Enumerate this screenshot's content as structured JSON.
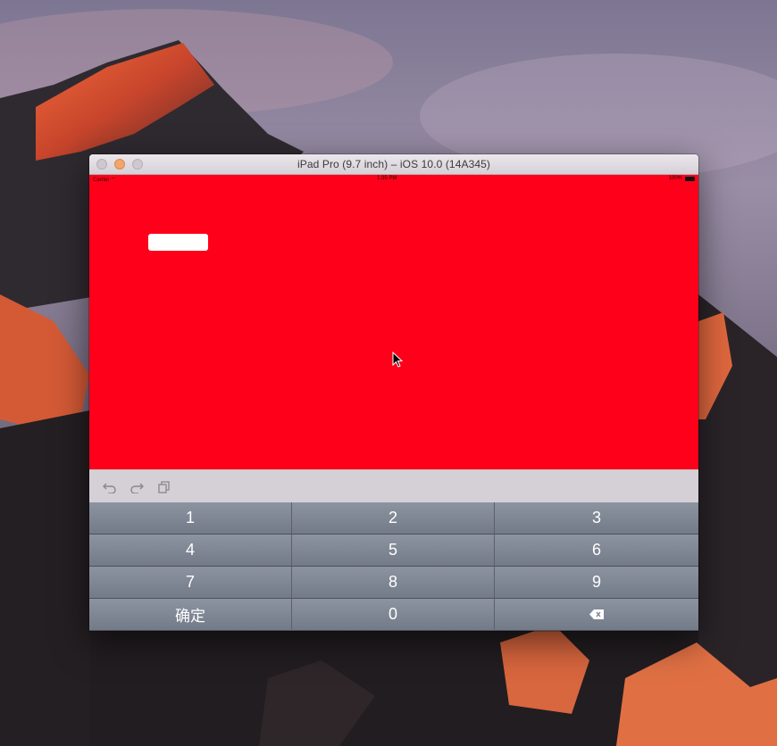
{
  "window": {
    "title": "iPad Pro (9.7 inch) – iOS 10.0 (14A345)"
  },
  "statusbar": {
    "carrier": "Carrier ⌔",
    "time": "1:35 PM",
    "battery": "100%"
  },
  "content": {
    "background": "#fe001a",
    "textfield_value": ""
  },
  "shortcut_bar": {
    "icons": [
      "undo-icon",
      "redo-icon",
      "paste-icon"
    ]
  },
  "keypad": {
    "keys": [
      "1",
      "2",
      "3",
      "4",
      "5",
      "6",
      "7",
      "8",
      "9",
      "确定",
      "0",
      "⌫"
    ]
  }
}
